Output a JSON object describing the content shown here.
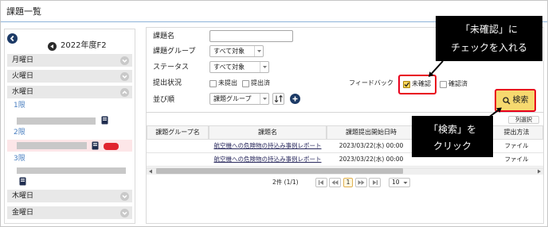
{
  "page": {
    "title": "課題一覧"
  },
  "sidebar": {
    "year_label": "2022年度F2",
    "days": [
      {
        "label": "月曜日",
        "expanded": false
      },
      {
        "label": "火曜日",
        "expanded": false
      },
      {
        "label": "水曜日",
        "expanded": true
      },
      {
        "label": "木曜日",
        "expanded": false
      },
      {
        "label": "金曜日",
        "expanded": false
      }
    ],
    "periods": [
      "1限",
      "2限",
      "3限"
    ]
  },
  "filters": {
    "task_name": {
      "label": "課題名",
      "value": ""
    },
    "task_group": {
      "label": "課題グループ",
      "value": "すべて対象"
    },
    "status": {
      "label": "ステータス",
      "value": "すべて対象"
    },
    "submission": {
      "label": "提出状況",
      "options": [
        {
          "label": "未提出",
          "checked": false
        },
        {
          "label": "提出済",
          "checked": false
        }
      ]
    },
    "feedback": {
      "label": "フィードバック",
      "options": [
        {
          "label": "未確認",
          "checked": true
        },
        {
          "label": "確認済",
          "checked": false
        }
      ]
    },
    "sort": {
      "label": "並び順",
      "value": "課題グループ"
    }
  },
  "search_button": {
    "label": "検索"
  },
  "table": {
    "column_select_label": "列選択",
    "headers": [
      "課題グループ名",
      "課題名",
      "課題提出開始日時",
      "提出方法"
    ],
    "rows": [
      {
        "group": "",
        "name": "航空機への危険物の持込み事例レポート",
        "start": "2023/03/22(水) 00:00",
        "method": "ファイル"
      },
      {
        "group": "",
        "name": "航空機への危険物の持込み事例レポート",
        "start": "2023/03/22(水) 00:00",
        "method": "ファイル"
      }
    ]
  },
  "pager": {
    "summary": "2件 (1/1)",
    "current_page": "1",
    "page_size": "10"
  },
  "callouts": [
    {
      "lines": [
        "「未確認」に",
        "チェックを入れる"
      ]
    },
    {
      "lines": [
        "「検索」を",
        "クリック"
      ]
    }
  ],
  "colors": {
    "highlight_red": "#e8001c",
    "search_button_yellow": "#f6d96f",
    "callout_background": "#000000",
    "period_label_blue": "#4a7fc0",
    "icon_navy": "#1c3a66"
  }
}
